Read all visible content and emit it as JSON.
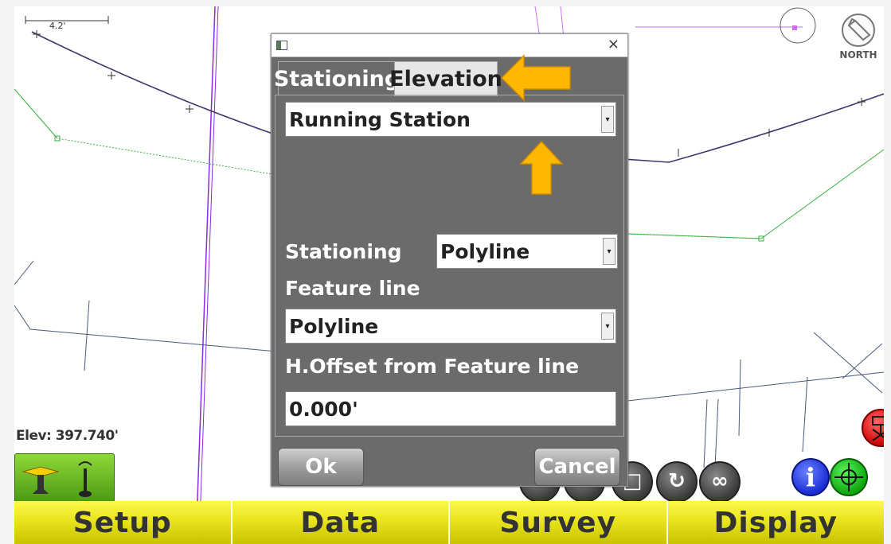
{
  "map": {
    "scale_label": "4.2'",
    "north_label": "NORTH",
    "elevation_readout": "Elev: 397.740'"
  },
  "dialog": {
    "close_symbol": "×",
    "tabs": [
      {
        "label": "Stationing",
        "active": true
      },
      {
        "label": "Elevation",
        "active": false
      }
    ],
    "station_mode_value": "Running Station",
    "stationing_label": "Stationing",
    "stationing_value": "Polyline",
    "feature_line_label": "Feature line",
    "feature_line_value": "Polyline",
    "h_offset_label": "H.Offset from Feature line",
    "h_offset_value": "0.000'",
    "ok_label": "Ok",
    "cancel_label": "Cancel"
  },
  "bottom_nav": [
    "Setup",
    "Data",
    "Survey",
    "Display"
  ],
  "icons": {
    "info": "info-icon",
    "target": "target-icon",
    "remove_point": "remove-point-icon",
    "gps": "gps-receiver-icon",
    "rotate": "rotate-icon",
    "infinity": "infinity-icon"
  },
  "colors": {
    "nav_yellow": "#e8e41e",
    "dialog_gray": "#6b6b6b",
    "highlight_arrow": "#ffb800"
  }
}
